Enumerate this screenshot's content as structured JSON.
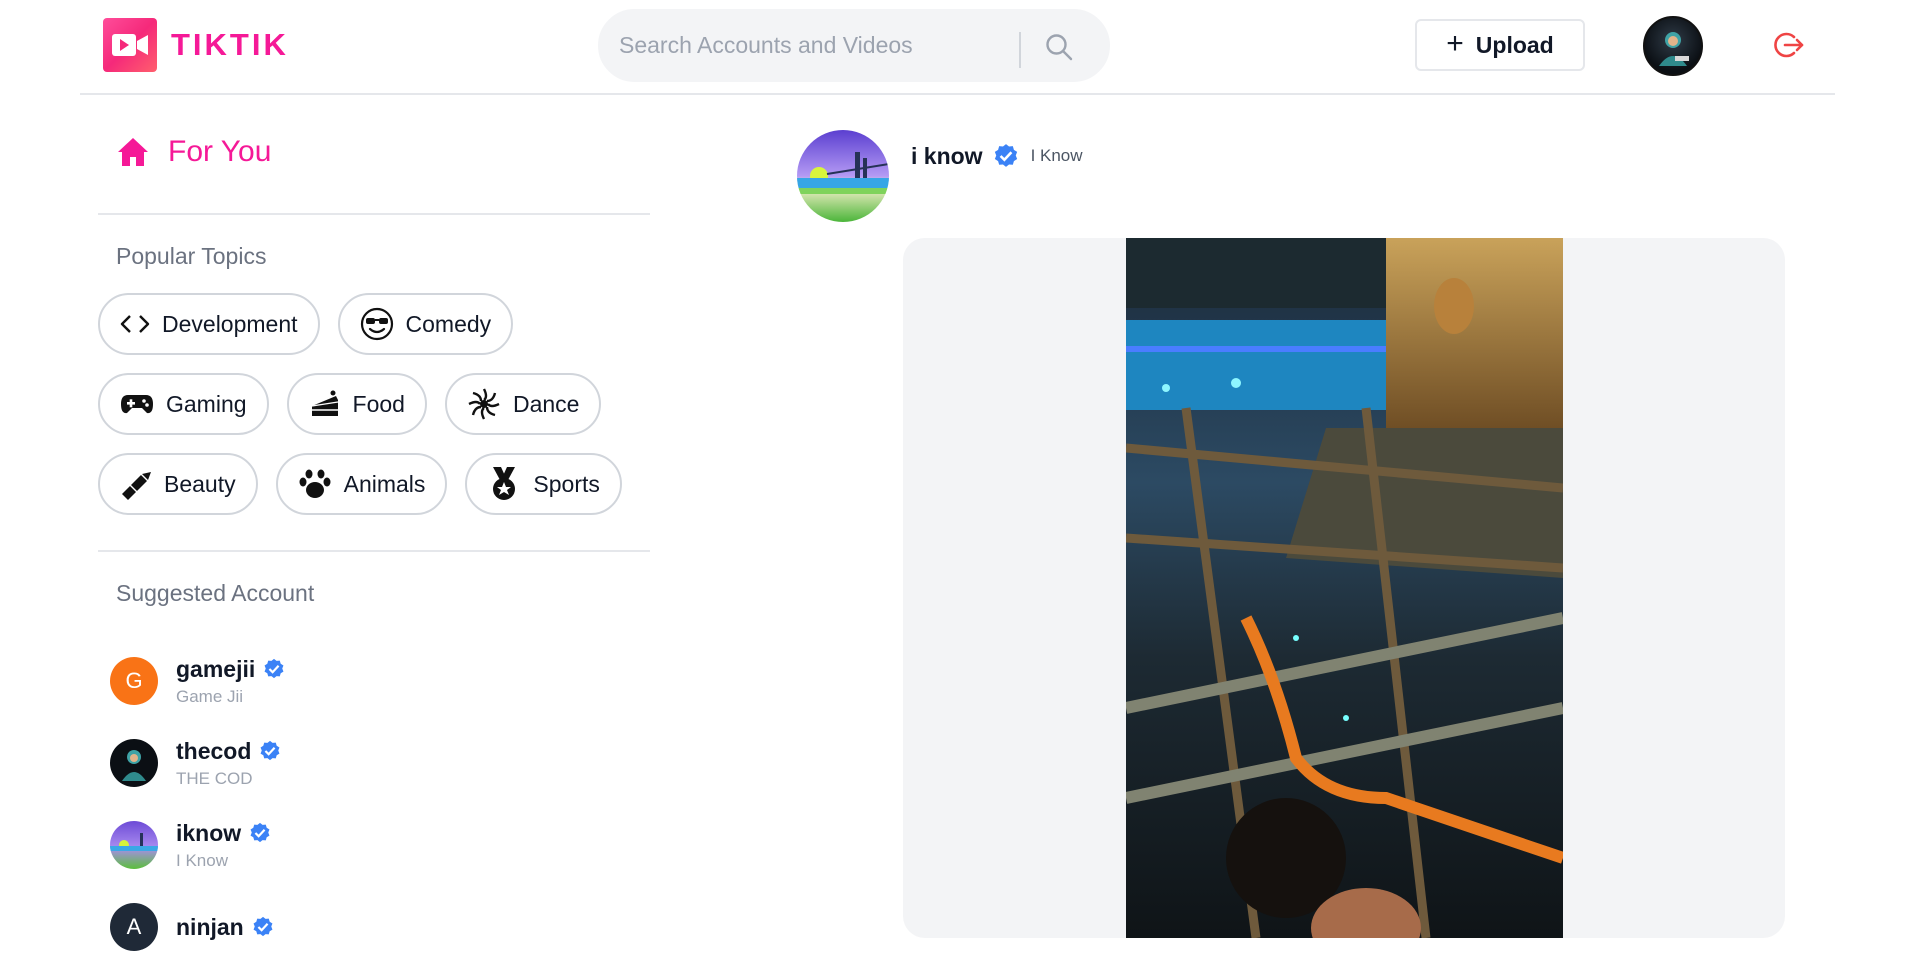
{
  "brand": {
    "logo_text": "TIKTIK",
    "accent": "#f51997"
  },
  "search": {
    "placeholder": "Search Accounts and Videos",
    "value": ""
  },
  "header": {
    "upload_label": "Upload"
  },
  "sidebar": {
    "for_you": "For You",
    "popular_title": "Popular Topics",
    "topics": [
      {
        "label": "Development",
        "icon": "code-icon"
      },
      {
        "label": "Comedy",
        "icon": "sunglasses-face-icon"
      },
      {
        "label": "Gaming",
        "icon": "gamepad-icon"
      },
      {
        "label": "Food",
        "icon": "cake-icon"
      },
      {
        "label": "Dance",
        "icon": "dance-burst-icon"
      },
      {
        "label": "Beauty",
        "icon": "lipstick-icon"
      },
      {
        "label": "Animals",
        "icon": "paw-icon"
      },
      {
        "label": "Sports",
        "icon": "medal-icon"
      }
    ],
    "suggested_title": "Suggested Account",
    "accounts": [
      {
        "username": "gamejii",
        "name": "Game Jii",
        "avatar_letter": "G",
        "avatar_color": "#f97316"
      },
      {
        "username": "thecod",
        "name": "THE COD"
      },
      {
        "username": "iknow",
        "name": "I Know"
      },
      {
        "username": "ninjan",
        "avatar_letter": "A"
      }
    ]
  },
  "post": {
    "username": "i know",
    "name": "I Know",
    "verified_color": "#3b82f6"
  }
}
